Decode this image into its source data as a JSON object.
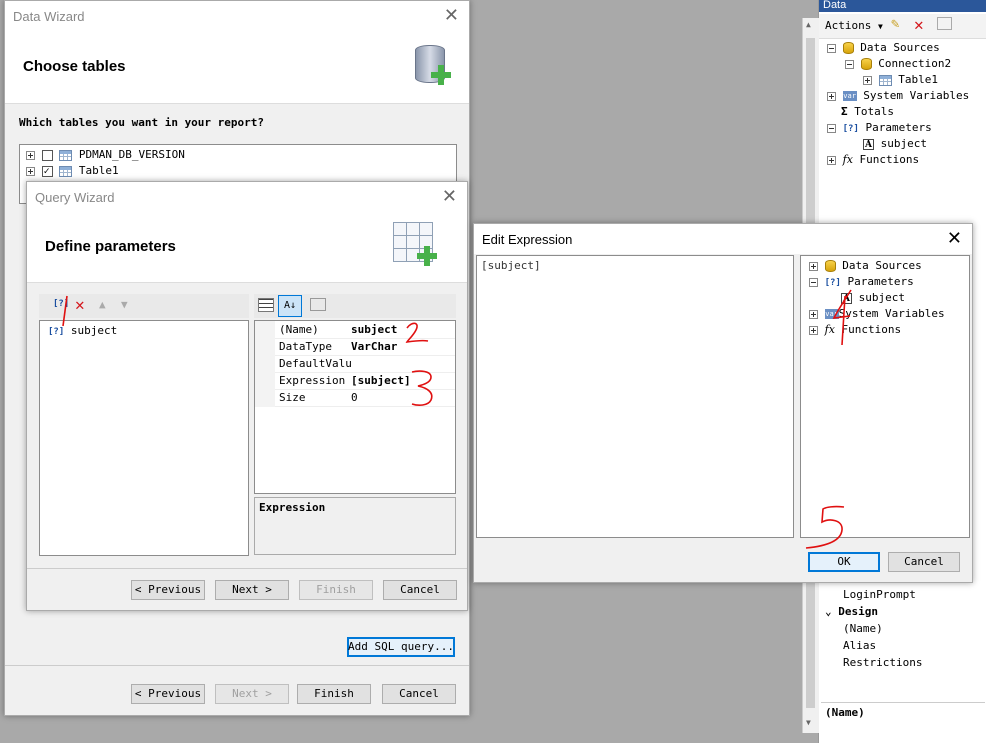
{
  "right_panel": {
    "header": "Data",
    "actions_label": "Actions",
    "tree": [
      {
        "label": "Data Sources",
        "icon": "database-icon"
      },
      {
        "label": "Connection2",
        "icon": "database-icon"
      },
      {
        "label": "Table1",
        "icon": "table-icon"
      },
      {
        "label": "System Variables",
        "icon": "var-icon"
      },
      {
        "label": "Totals",
        "icon": "sigma-icon"
      },
      {
        "label": "Parameters",
        "icon": "parameter-icon"
      },
      {
        "label": "subject",
        "icon": "text-icon"
      },
      {
        "label": "Functions",
        "icon": "function-icon"
      }
    ],
    "props_rows": [
      {
        "label": "LoginPrompt"
      },
      {
        "label": "Design",
        "group": true
      },
      {
        "label": "(Name)"
      },
      {
        "label": "Alias"
      },
      {
        "label": "Restrictions"
      }
    ],
    "description": "(Name)"
  },
  "data_wizard": {
    "title": "Data Wizard",
    "heading": "Choose tables",
    "question": "Which tables you want in your report?",
    "tables": [
      "PDMAN_DB_VERSION",
      "Table1"
    ],
    "add_sql_label": "Add SQL query...",
    "buttons": {
      "previous": "< Previous",
      "next": "Next >",
      "finish": "Finish",
      "cancel": "Cancel"
    }
  },
  "query_wizard": {
    "title": "Query Wizard",
    "heading": "Define parameters",
    "param_list": [
      "subject"
    ],
    "properties": [
      {
        "key": "(Name)",
        "value": "subject"
      },
      {
        "key": "DataType",
        "value": "VarChar"
      },
      {
        "key": "DefaultValu",
        "value": ""
      },
      {
        "key": "Expression",
        "value": "[subject]"
      },
      {
        "key": "Size",
        "value": "0"
      }
    ],
    "description": "Expression",
    "buttons": {
      "previous": "< Previous",
      "next": "Next >",
      "finish": "Finish",
      "cancel": "Cancel"
    }
  },
  "edit_expression": {
    "title": "Edit Expression",
    "expression": "[subject]",
    "tree": [
      {
        "label": "Data Sources"
      },
      {
        "label": "Parameters"
      },
      {
        "label": "subject"
      },
      {
        "label": "System Variables"
      },
      {
        "label": "Functions"
      }
    ],
    "ok_label": "OK",
    "cancel_label": "Cancel"
  },
  "annotations": [
    "1",
    "2",
    "3",
    "4",
    "5"
  ],
  "colors": {
    "accent": "#0078d7",
    "annotation_red": "#e01010",
    "backdrop": "#a9a9a9"
  }
}
